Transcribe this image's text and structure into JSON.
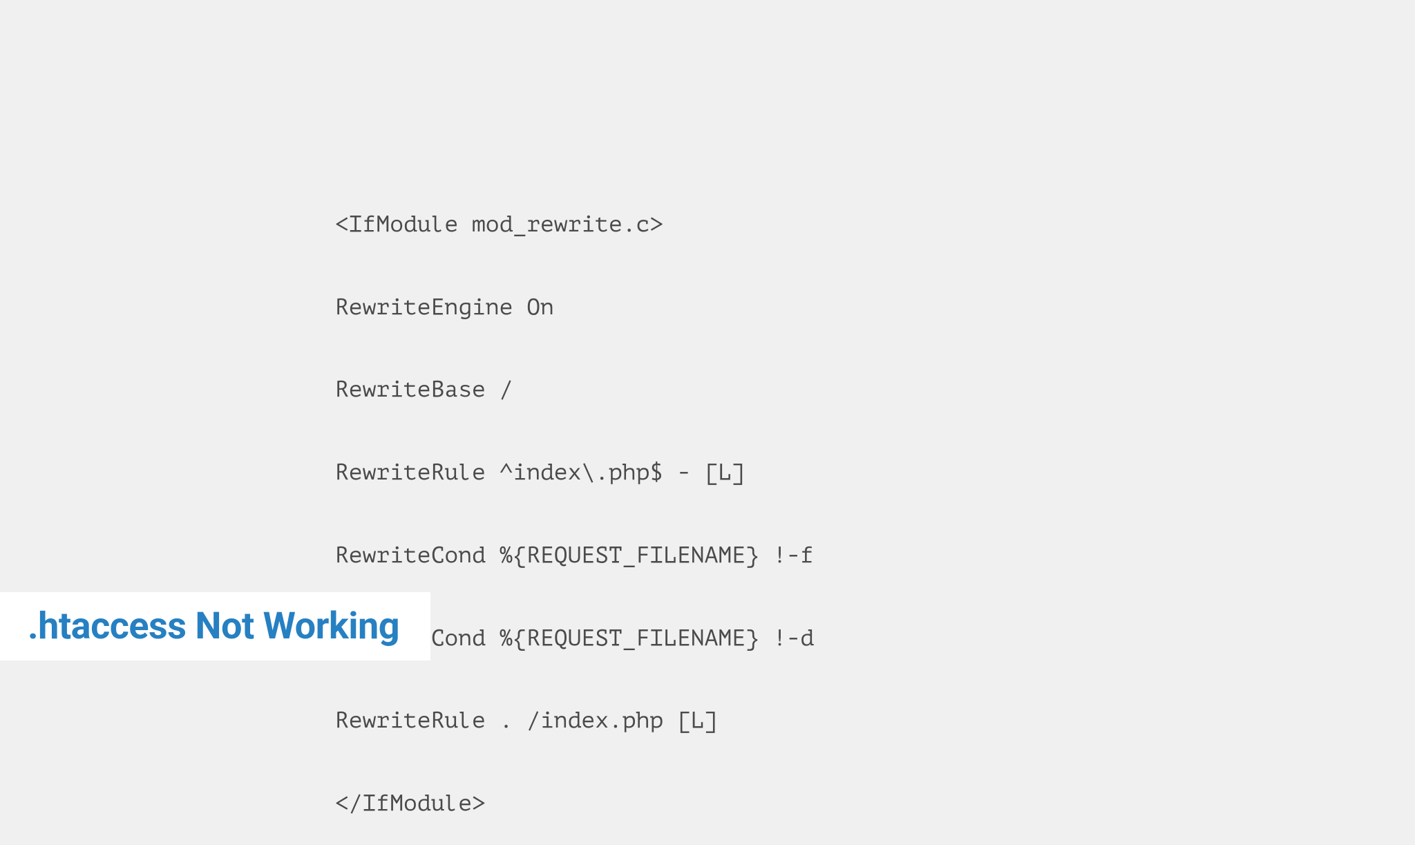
{
  "code": {
    "lines": [
      "<IfModule mod_rewrite.c>",
      "RewriteEngine On",
      "RewriteBase /",
      "RewriteRule ^index\\.php$ - [L]",
      "RewriteCond %{REQUEST_FILENAME} !-f",
      "RewriteCond %{REQUEST_FILENAME} !-d",
      "RewriteRule . /index.php [L]",
      "</IfModule>"
    ]
  },
  "title": ".htaccess Not Working"
}
